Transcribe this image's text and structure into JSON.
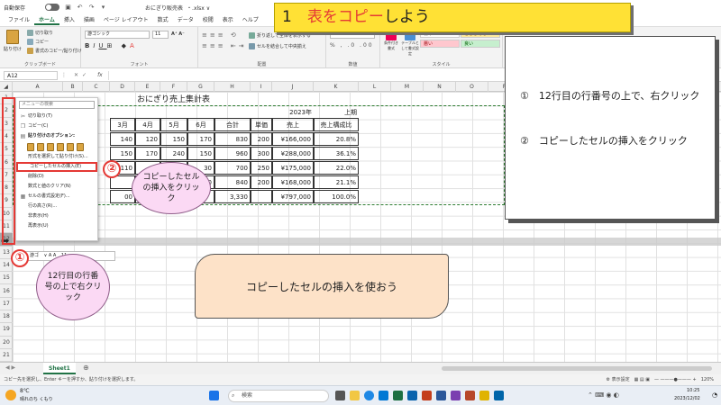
{
  "titlebar": {
    "autosave": "自動保存",
    "filename": "おにぎり販売表",
    "ext": "・.xlsx ∨"
  },
  "tabs": [
    "ファイル",
    "ホーム",
    "挿入",
    "描画",
    "ページ レイアウト",
    "数式",
    "データ",
    "校閲",
    "表示",
    "ヘルプ"
  ],
  "ribbon": {
    "paste": "貼り付け",
    "cut": "切り取り",
    "copy": "コピー",
    "format_painter": "書式のコピー/貼り付け",
    "clipboard": "クリップボード",
    "font_name": "游ゴシック",
    "font_size": "11",
    "font": "フォント",
    "wrap": "折り返して全体を表示する",
    "merge": "セルを結合して中央揃え",
    "alignment": "配置",
    "number": "数値",
    "cond_format": "条件付き書式",
    "table_format": "テーブルとして書式設定",
    "styles": "スタイル",
    "style_normal": "標準",
    "style_neutral": "どちらでも...",
    "style_bad": "悪い",
    "style_good": "良い"
  },
  "formula": {
    "namebox": "A12",
    "fx": "fx"
  },
  "columns": [
    "A",
    "B",
    "C",
    "D",
    "E",
    "F",
    "G",
    "H",
    "I",
    "J",
    "K",
    "L",
    "M",
    "N",
    "O",
    "P"
  ],
  "rows": [
    "1",
    "2",
    "3",
    "4",
    "5",
    "6",
    "7",
    "8",
    "9",
    "10",
    "11",
    "12",
    "13",
    "14",
    "15",
    "16",
    "17",
    "18",
    "19",
    "20",
    "21"
  ],
  "sheet": {
    "title": "おにぎり売上集計表",
    "year": "2023年",
    "half": "上期",
    "headers": [
      "月",
      "3月",
      "4月",
      "5月",
      "6月",
      "合計",
      "単価",
      "売上",
      "売上構成比"
    ],
    "rows": [
      [
        "140",
        "120",
        "150",
        "170",
        "830",
        "200",
        "¥166,000",
        "20.8%"
      ],
      [
        "150",
        "170",
        "240",
        "150",
        "960",
        "300",
        "¥288,000",
        "36.1%"
      ],
      [
        "110",
        "",
        "",
        "30",
        "700",
        "250",
        "¥175,000",
        "22.0%"
      ],
      [
        "",
        "",
        "",
        "40",
        "840",
        "200",
        "¥168,000",
        "21.1%"
      ],
      [
        "00",
        "53",
        "",
        "",
        "3,330",
        "",
        "¥797,000",
        "100.0%"
      ]
    ]
  },
  "context_menu": {
    "search": "メニューの検索",
    "items": [
      "切り取り(T)",
      "コピー(C)",
      "貼り付けのオプション:",
      "形式を選択して貼り付け(S)...",
      "コピーしたセルの挿入(E)",
      "削除(D)",
      "数式と値のクリア(N)",
      "セルの書式設定(F)...",
      "行の高さ(R)...",
      "非表示(H)",
      "再表示(U)"
    ]
  },
  "mini_toolbar": {
    "font": "游ゴ",
    "size": "11"
  },
  "annotations": {
    "title_num": "1",
    "title_red": "表をコピー",
    "title_rest": "しよう",
    "step1": "①　12行目の行番号の上で、右クリック",
    "step2": "②　コピーしたセルの挿入をクリック",
    "banner": "コピーしたセルの挿入を使おう",
    "badge1": "①",
    "badge2": "②",
    "bubble1": "12行目の行番号の上で右クリック",
    "bubble2": "コピーしたセルの挿入をクリック"
  },
  "sheet_tab": "Sheet1",
  "status": {
    "text": "コピー先を選択し、Enter キーを押すか、貼り付けを選択します。",
    "display": "表示設定",
    "zoom": "120%"
  },
  "taskbar": {
    "weather_temp": "8℃",
    "weather_desc": "晴れのち くもり",
    "search": "検索",
    "time": "10:25",
    "date": "2023/12/02"
  }
}
